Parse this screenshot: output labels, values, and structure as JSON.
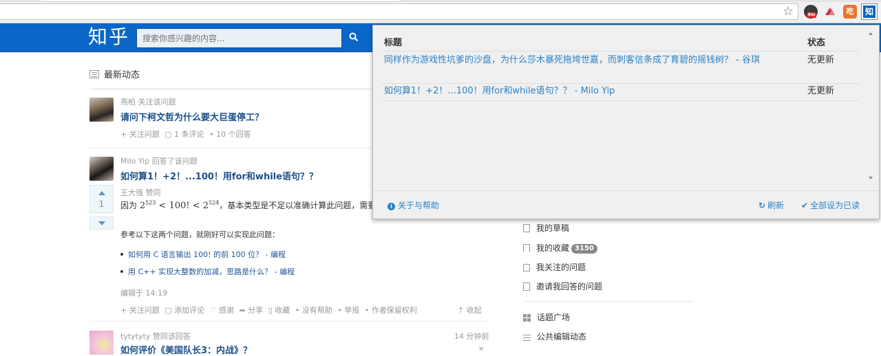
{
  "browser": {
    "star_glyph": "☆",
    "extensions": [
      {
        "name": "bm-extension-icon",
        "label": "8m"
      },
      {
        "name": "triangle-extension-icon",
        "label": ""
      },
      {
        "name": "orange-extension-icon",
        "label": "吃"
      },
      {
        "name": "zhihu-extension-icon",
        "label": "知"
      }
    ]
  },
  "header": {
    "logo": "知乎",
    "search_placeholder": "搜索你感兴趣的内容...",
    "search_icon": "search-icon"
  },
  "feed": {
    "heading": "最新动态",
    "items": [
      {
        "meta": "燕柏 关注该问题",
        "title": "请问下柯文哲为什么要大巨蛋停工？",
        "actions": [
          "+ 关注问题",
          "▢ 1 条评论",
          "• 10 个回答"
        ]
      },
      {
        "meta": "Milo Yip 回答了该问题",
        "title": "如何算1！+2！...100！用for和while语句？？",
        "vote_count": "1",
        "voter": "王大强 赞同",
        "body_prefix": "因为",
        "math": {
          "base1": "2",
          "exp1": "523",
          "mid": " < 100! < ",
          "base2": "2",
          "exp2": "524"
        },
        "body_suffix": "，基本类型是不足以准确计算此问题，需要",
        "para2": "参考以下这两个问题，就刚好可以实现此问题：",
        "links": [
          {
            "text": "如何用 C 语言输出 100! 的前 100 位？",
            "suffix": " - 编程"
          },
          {
            "text": "用 C++ 实现大整数的加减，思路是什么？",
            "suffix": " - 编程"
          }
        ],
        "edited": "编辑于 14:19",
        "actions": [
          "+ 关注问题",
          "▢ 添加评论",
          "♡ 感谢",
          "➦ 分享",
          "▯ 收藏",
          "• 没有帮助",
          "• 举报",
          "• 作者保留权利"
        ],
        "collapse": "⇡ 收起"
      },
      {
        "meta": "tytytyty 赞同该回答",
        "time": "14 分钟前",
        "title": "如何评价《美国队长3：内战》？"
      }
    ]
  },
  "sidebar": {
    "items": [
      {
        "label": "我的草稿",
        "icon": "draft-icon"
      },
      {
        "label": "我的收藏",
        "icon": "bookmark-icon",
        "badge": "3150"
      },
      {
        "label": "我关注的问题",
        "icon": "check-icon"
      },
      {
        "label": "邀请我回答的问题",
        "icon": "invite-icon"
      },
      {
        "label": "话题广场",
        "icon": "grid-icon"
      },
      {
        "label": "公共编辑动态",
        "icon": "list-icon"
      }
    ]
  },
  "popup": {
    "col_title": "标题",
    "col_status": "状态",
    "rows": [
      {
        "title": "同样作为游戏性坑爹的沙盘，为什么莎木暴死拖垮世嘉，而刺客信条成了育碧的摇钱树？ - 谷琪",
        "status": "无更新"
      },
      {
        "title": "如何算1！+2！...100！用for和while语句？？ - Milo Yip",
        "status": "无更新"
      }
    ],
    "about": "关于与帮助",
    "refresh": "刷新",
    "mark_all": "全部设为已读"
  },
  "colors": {
    "zhihu_blue": "#0a67c8",
    "link_blue": "#2b81c5",
    "title_blue": "#1a4f8b"
  }
}
